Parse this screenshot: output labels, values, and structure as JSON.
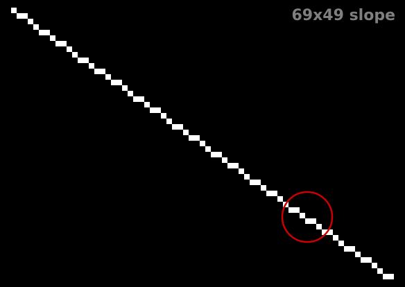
{
  "title": "69x49 slope",
  "line": {
    "run": 69,
    "rise": 49,
    "color": "#ffffff"
  },
  "highlight": {
    "shape": "circle",
    "color": "#cc0000"
  },
  "background_color": "#000000"
}
